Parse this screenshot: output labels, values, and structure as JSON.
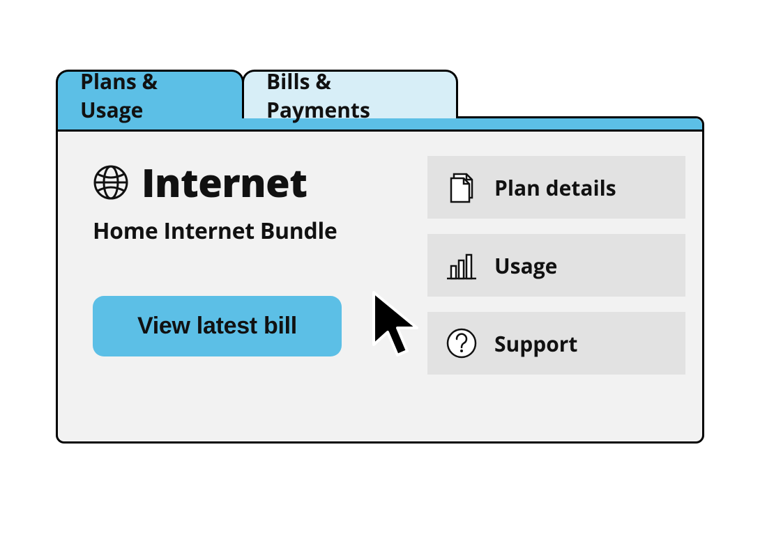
{
  "tabs": {
    "active": "Plans & Usage",
    "inactive": "Bills & Payments"
  },
  "main": {
    "heading": "Internet",
    "subheading": "Home Internet Bundle",
    "cta_label": "View latest bill"
  },
  "sidebar": {
    "items": [
      {
        "label": "Plan details"
      },
      {
        "label": "Usage"
      },
      {
        "label": "Support"
      }
    ]
  }
}
